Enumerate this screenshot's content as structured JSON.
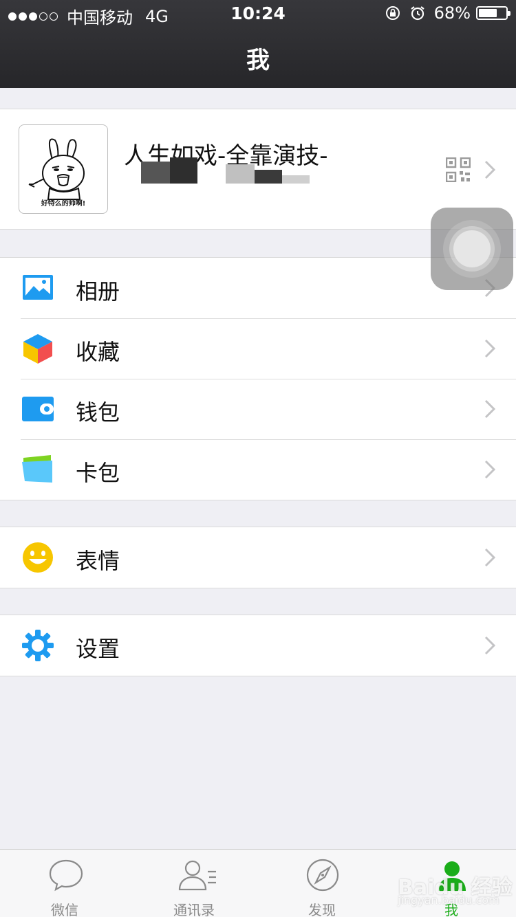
{
  "status_bar": {
    "carrier": "中国移动",
    "network": "4G",
    "time": "10:24",
    "battery_percent": "68%",
    "battery_level": 0.68
  },
  "nav": {
    "title": "我"
  },
  "profile": {
    "nickname": "人生如戏-全靠演技-",
    "avatar_caption": "好特么的帅啊!"
  },
  "menu": {
    "album": "相册",
    "favorites": "收藏",
    "wallet": "钱包",
    "card_pack": "卡包",
    "stickers": "表情",
    "settings": "设置"
  },
  "tabs": {
    "chats": "微信",
    "contacts": "通讯录",
    "discover": "发现",
    "me": "我"
  },
  "watermark": {
    "brand": "Baidu 经验",
    "url": "jingyan.baidu.com"
  },
  "colors": {
    "nav_bg": "#2a2a2e",
    "page_bg": "#efeff4",
    "accent_green": "#1aad19",
    "icon_blue": "#1e9bf0",
    "sticker_yellow": "#f7c600"
  }
}
